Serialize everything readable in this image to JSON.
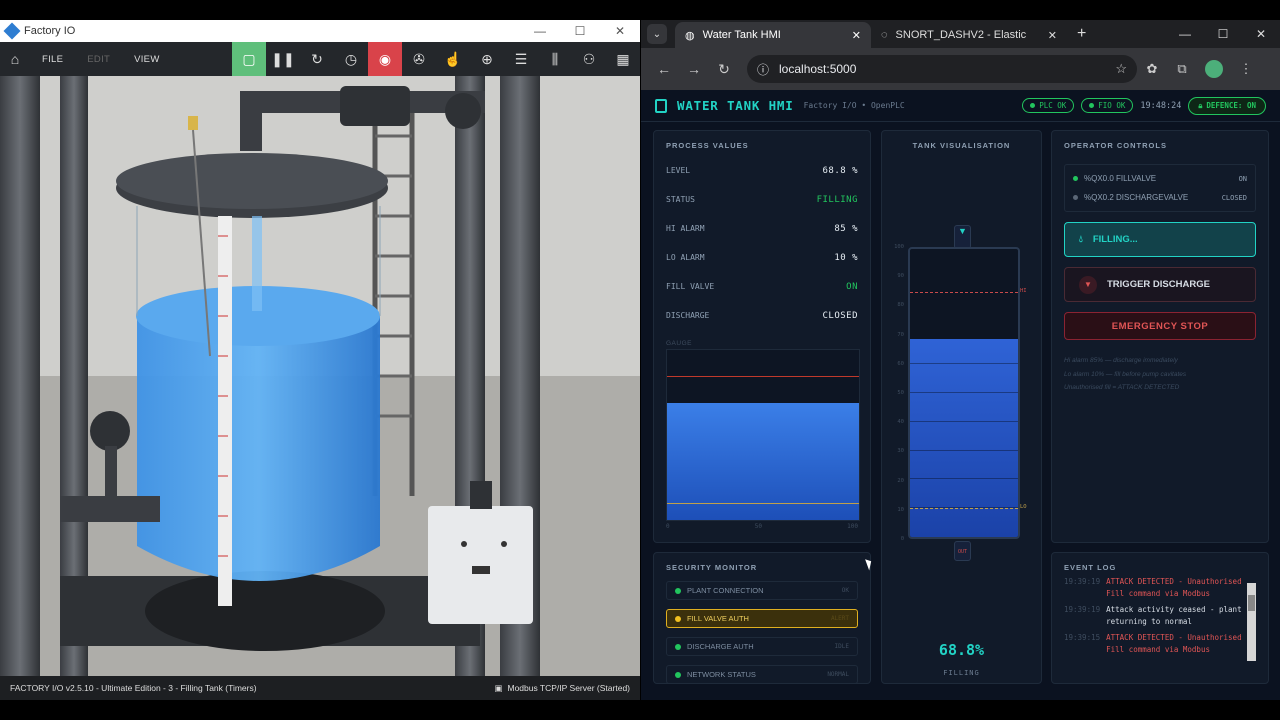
{
  "factory_io": {
    "window_title": "Factory IO",
    "menu": {
      "file": "FILE",
      "edit": "EDIT",
      "view": "VIEW"
    },
    "status_left": "FACTORY I/O v2.5.10 - Ultimate Edition - 3 - Filling Tank (Timers)",
    "status_right": "Modbus TCP/IP Server (Started)"
  },
  "browser": {
    "tabs": [
      {
        "label": "Water Tank HMI",
        "active": true
      },
      {
        "label": "SNORT_DASHV2 - Elastic",
        "active": false
      }
    ],
    "url": "localhost:5000"
  },
  "hmi": {
    "title": "WATER TANK HMI",
    "subtitle": "Factory I/O • OpenPLC",
    "chips": {
      "plc": "PLC OK",
      "fio": "FIO OK",
      "clock": "19:48:24",
      "defence": "DEFENCE: ON"
    },
    "process_values": {
      "title": "PROCESS VALUES",
      "rows": [
        {
          "label": "LEVEL",
          "value": "68.8 %"
        },
        {
          "label": "STATUS",
          "value": "FILLING"
        },
        {
          "label": "HI ALARM",
          "value": "85 %"
        },
        {
          "label": "LO ALARM",
          "value": "10 %"
        },
        {
          "label": "FILL VALVE",
          "value": "ON"
        },
        {
          "label": "DISCHARGE",
          "value": "CLOSED"
        }
      ],
      "gauge_label": "GAUGE",
      "gauge_axis": [
        "0",
        "50",
        "100"
      ],
      "level_pct": 68.8,
      "hi_pct": 85,
      "lo_pct": 10
    },
    "tank": {
      "title": "TANK VISUALISATION",
      "ticks": [
        "100",
        "90",
        "80",
        "70",
        "60",
        "50",
        "40",
        "30",
        "20",
        "10",
        "0"
      ],
      "hi_tag": "HI",
      "lo_tag": "LO",
      "out_tag": "OUT",
      "value": "68.8%",
      "status": "FILLING"
    },
    "controls": {
      "title": "OPERATOR CONTROLS",
      "coils": [
        {
          "label": "%QX0.0 FILLVALVE",
          "state": "ON",
          "color": "#22c55e"
        },
        {
          "label": "%QX0.2 DISCHARGEVALVE",
          "state": "CLOSED",
          "color": "#5a6676"
        }
      ],
      "fill_button": "FILLING...",
      "discharge_button": "TRIGGER DISCHARGE",
      "stop_button": "EMERGENCY STOP",
      "notes": [
        "Hi alarm 85% — discharge immediately",
        "Lo alarm 10% — fill before pump cavitates",
        "Unauthorised fill = ATTACK DETECTED"
      ]
    },
    "security": {
      "title": "SECURITY MONITOR",
      "rows": [
        {
          "label": "PLANT CONNECTION",
          "state": "OK"
        },
        {
          "label": "FILL VALVE AUTH",
          "state": "ALERT"
        },
        {
          "label": "DISCHARGE AUTH",
          "state": "IDLE"
        },
        {
          "label": "NETWORK STATUS",
          "state": "NORMAL"
        }
      ]
    },
    "events": {
      "title": "EVENT LOG",
      "items": [
        {
          "time": "19:39:19",
          "text": "ATTACK DETECTED - Unauthorised Fill command via Modbus",
          "attack": true
        },
        {
          "time": "19:39:19",
          "text": "Attack activity ceased - plant returning to normal",
          "attack": false
        },
        {
          "time": "19:39:15",
          "text": "ATTACK DETECTED - Unauthorised Fill command via Modbus",
          "attack": true
        }
      ]
    }
  }
}
